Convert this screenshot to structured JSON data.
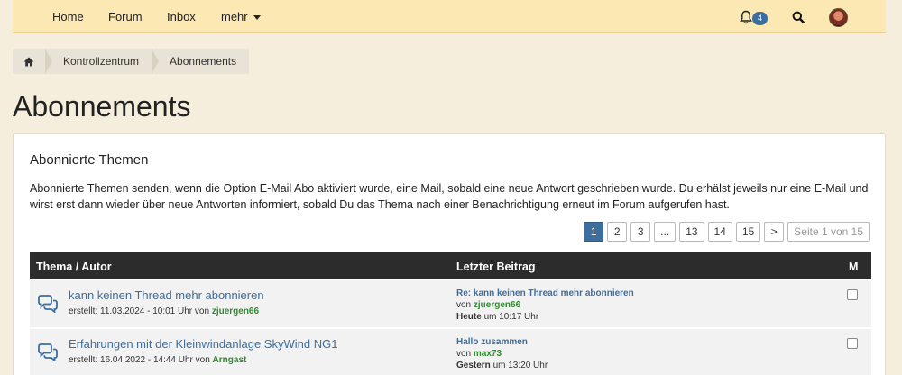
{
  "nav": {
    "items": [
      "Home",
      "Forum",
      "Inbox",
      "mehr"
    ],
    "notification_count": "4"
  },
  "breadcrumb": [
    "Kontrollzentrum",
    "Abonnements"
  ],
  "page": {
    "title": "Abonnements"
  },
  "panel": {
    "title": "Abonnierte Themen",
    "description": "Abonnierte Themen senden, wenn die Option E-Mail Abo aktiviert wurde, eine Mail, sobald eine neue Antwort geschrieben wurde. Du erhälst jeweils nur eine E-Mail und wirst erst dann wieder über neue Antworten informiert, sobald Du das Thema nach einer Benachrichtigung erneut im Forum aufgerufen hast."
  },
  "pagination": {
    "pages": [
      "1",
      "2",
      "3",
      "...",
      "13",
      "14",
      "15",
      ">"
    ],
    "active": "1",
    "info": "Seite 1 von 15"
  },
  "table": {
    "headers": [
      "Thema / Autor",
      "Letzter Beitrag",
      "M"
    ],
    "rows": [
      {
        "title": "kann keinen Thread mehr abonnieren",
        "created_prefix": "erstellt: 11.03.2024 - 10:01 Uhr von",
        "author": "zjuergen66",
        "last_title": "Re: kann keinen Thread mehr abonnieren",
        "last_by_prefix": "von",
        "last_author": "zjuergen66",
        "last_day": "Heute",
        "last_time": "um 10:17 Uhr"
      },
      {
        "title": "Erfahrungen mit der Kleinwindanlage SkyWind NG1",
        "created_prefix": "erstellt: 16.04.2022 - 14:44 Uhr von",
        "author": "Arngast",
        "last_title": "Hallo zusammen",
        "last_by_prefix": "von",
        "last_author": "max73",
        "last_day": "Gestern",
        "last_time": "um 13:20 Uhr"
      }
    ]
  },
  "colors": {
    "navbar": "#fce8b3",
    "accent": "#3d6e9e",
    "author_green": "#2e8b2e",
    "table_header": "#2c2c2c"
  }
}
